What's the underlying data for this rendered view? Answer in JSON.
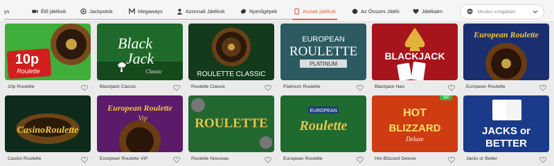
{
  "tabs": [
    {
      "label": "ys",
      "icon": "",
      "active": false
    },
    {
      "label": "Élő játékok",
      "icon": "camera-icon",
      "active": false
    },
    {
      "label": "Jackpotok",
      "icon": "jackpot-icon",
      "active": false
    },
    {
      "label": "Megaways",
      "icon": "megaways-icon",
      "active": false
    },
    {
      "label": "Azonnali Játékok",
      "icon": "user-icon",
      "active": false
    },
    {
      "label": "Nyerőgépek",
      "icon": "slot-icon",
      "active": false
    },
    {
      "label": "Asztali játékok",
      "icon": "cards-icon",
      "active": true
    },
    {
      "label": "Az Összes Játék",
      "icon": "grid-icon",
      "active": false
    },
    {
      "label": "Játékaim",
      "icon": "heart-icon",
      "active": false
    }
  ],
  "provider_select": {
    "value": "Minden szolgáltató",
    "icon": "gamepad-icon"
  },
  "games": [
    {
      "name": "10p Roulette",
      "art": "10p\nRoulette"
    },
    {
      "name": "Blackjack Classic",
      "art": "Black\nJack\nClassic"
    },
    {
      "name": "Roulette Classic",
      "art": "ROULETTE CLASSIC"
    },
    {
      "name": "Platinum Roulette",
      "art": "EUROPEAN\nROULETTE\nPLATINUM"
    },
    {
      "name": "Blackjack Neo",
      "art": "BLACKJACK"
    },
    {
      "name": "European Roulette",
      "art": "European Roulette"
    },
    {
      "name": "Casino Roulette",
      "art": "CasinoRoulette"
    },
    {
      "name": "European Roulette VIP",
      "art": "European Roulette\nVip"
    },
    {
      "name": "Roulette Nouveau",
      "art": "ROULETTE"
    },
    {
      "name": "European Roulette",
      "art": "EUROPEAN\nRoulette"
    },
    {
      "name": "Hot Blizzard Deluxe",
      "art": "HOT\nBLIZZARD\nDeluxe",
      "badge": "ÚJ"
    },
    {
      "name": "Jacks or Better",
      "art": "JACKS or\nBETTER"
    }
  ],
  "colors": {
    "accent": "#e8603c",
    "badge": "#3fb54a"
  }
}
